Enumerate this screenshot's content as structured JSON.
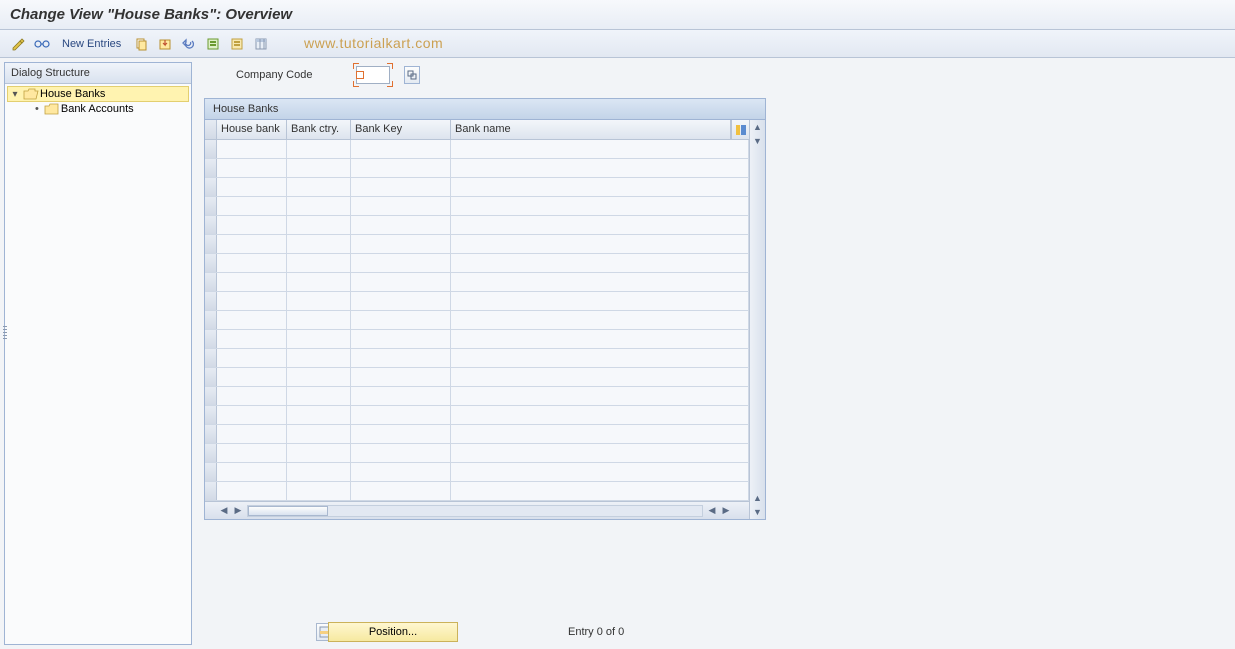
{
  "title": "Change View \"House Banks\": Overview",
  "toolbar": {
    "new_entries": "New Entries"
  },
  "watermark": "www.tutorialkart.com",
  "sidebar": {
    "header": "Dialog Structure",
    "items": [
      {
        "label": "House Banks",
        "selected": true
      },
      {
        "label": "Bank Accounts",
        "selected": false
      }
    ]
  },
  "fields": {
    "company_code": {
      "label": "Company Code",
      "value": ""
    }
  },
  "table": {
    "title": "House Banks",
    "columns": {
      "house_bank": "House bank",
      "bank_ctry": "Bank ctry.",
      "bank_key": "Bank Key",
      "bank_name": "Bank name"
    },
    "rows": []
  },
  "footer": {
    "position_btn": "Position...",
    "entry_text": "Entry 0 of 0"
  }
}
